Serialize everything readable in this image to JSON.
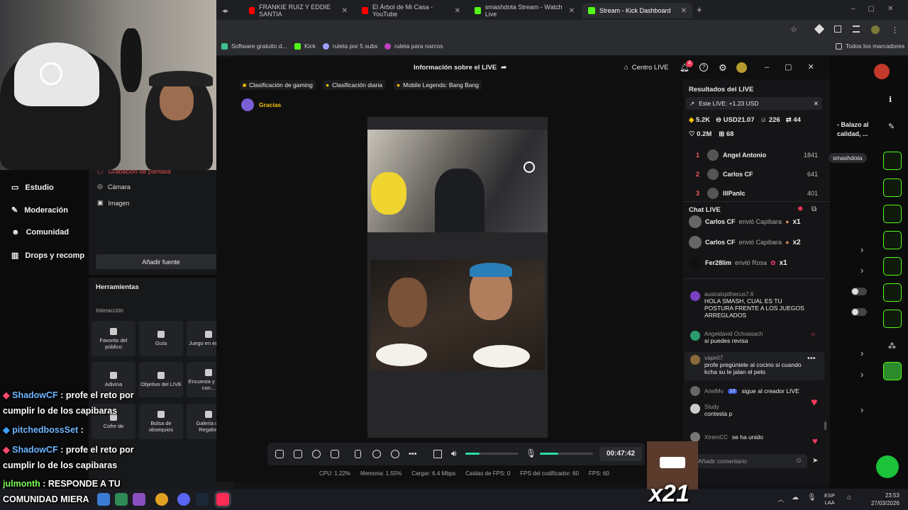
{
  "browser": {
    "tabs": [
      {
        "label": "FRANKIE RUIZ Y EDDIE SANTIA",
        "color": "#ff0000"
      },
      {
        "label": "El Árbol de Mi Casa - YouTube",
        "color": "#ff0000"
      },
      {
        "label": "smashdota Stream - Watch Live",
        "color": "#53fc18"
      },
      {
        "label": "Stream - Kick Dashboard",
        "color": "#53fc18"
      }
    ],
    "new_tab": "+",
    "bookmarks": [
      "Software gratuito d...",
      "Kick",
      "ruleta por 5 subs",
      "ruleta para narcos"
    ],
    "all_bookmarks": "Todos los marcadores"
  },
  "left_nav": {
    "items": [
      {
        "label": "Estudio",
        "icon": "monitor-icon"
      },
      {
        "label": "Moderación",
        "icon": "wrench-icon"
      },
      {
        "label": "Comunidad",
        "icon": "community-icon"
      },
      {
        "label": "Drops y recomp",
        "icon": "chart-icon"
      }
    ]
  },
  "sources": {
    "partial": "Grabación de pantalla",
    "items": [
      "Cámara",
      "Imagen"
    ],
    "add_button": "Añadir fuente"
  },
  "tools": {
    "title": "Herramientas",
    "section": "Interacción",
    "items": [
      "Favorito del público",
      "Guía",
      "Juego en equipo",
      "Adivina",
      "Objetivo del LIVE",
      "Encuesta y Votar con...",
      "Cofre de",
      "Bolsa de obsequios",
      "Galería de Regalos"
    ]
  },
  "modal": {
    "title": "Información sobre el LIVE",
    "centro": "Centro LIVE",
    "notif_count": "4",
    "chips": [
      "Clasificación de gaming",
      "Clasificación diaria",
      "Mobile Legends: Bang Bang"
    ],
    "gracias": "Gracias",
    "timer": "00:47:42",
    "stats": [
      "CPU: 1.22%",
      "Memoria: 1.55%",
      "Cargar: 6.4 Mbps",
      "Caídas de FPS: 0",
      "FPS del codificador: 60",
      "FPS: 60"
    ]
  },
  "results": {
    "title": "Resultados del LIVE",
    "this_live": "Este LIVE: +1.23 USD",
    "metrics": [
      "5.2K",
      "USD21.07",
      "226",
      "44",
      "0.2M",
      "68"
    ],
    "ranking": [
      {
        "rank": "1",
        "name": "Angel Antonio",
        "value": "1841"
      },
      {
        "rank": "2",
        "name": "Carlos CF",
        "value": "641"
      },
      {
        "rank": "3",
        "name": "lllPanlc",
        "value": "401"
      }
    ]
  },
  "chat": {
    "title": "Chat LIVE",
    "gifts": [
      {
        "user": "Carlos CF",
        "text": "envió Capibara",
        "mult": "x1"
      },
      {
        "user": "Carlos CF",
        "text": "envió Capibara",
        "mult": "x2"
      },
      {
        "user": "Fer28lim",
        "text": "envió Rosa",
        "mult": "x1"
      }
    ],
    "messages": [
      {
        "user": "australopithecus7.6",
        "text": "HOLA SMASH, CUAL ES TU POSTURA FRENTE A LOS JUEGOS ARREGLADOS",
        "color": "#7a3fc2"
      },
      {
        "user": "Angeldavid Ochoasach",
        "text": "si puedes revisa",
        "color": "#2a9d6f"
      },
      {
        "user": "vape07",
        "text": "profe pregúntele al cocino si cuando kcha su le jalan el pelo",
        "color": "#8a6a3a"
      },
      {
        "user": "ArielMv",
        "text": "sigue al creador LIVE",
        "color": "#666666",
        "badge": "10"
      },
      {
        "user": "Study",
        "text": "contesta p",
        "color": "#cccccc"
      },
      {
        "user": "XtremCC",
        "text": "se ha unido",
        "color": "#777777"
      }
    ],
    "input_placeholder": "Añadir comentario"
  },
  "kick_page": {
    "title_lines": [
      "- Balazo al",
      "calidad, ..."
    ],
    "channel_tag": "smashdota"
  },
  "overlay_chat": [
    {
      "user": "ShadowCF",
      "text": ": profe el reto por"
    },
    {
      "user": "",
      "text": "cumplir lo de los capibaras"
    },
    {
      "user": "pitchedbossSet",
      "text": ":"
    },
    {
      "user": "ShadowCF",
      "text": ": profe el reto por"
    },
    {
      "user": "",
      "text": "cumplir lo de los capibaras"
    },
    {
      "user": "julmonth",
      "text": ": RESPONDE A TU"
    },
    {
      "user": "",
      "text": "COMUNIDAD MIERA"
    }
  ],
  "emote_multiplier": "x21",
  "taskbar": {
    "lang": "ESP",
    "layout": "LAA",
    "time": "23:53",
    "date": "27/03/2026"
  },
  "colors": {
    "kick_green": "#53fc18",
    "accent_red": "#ff3b5c"
  }
}
